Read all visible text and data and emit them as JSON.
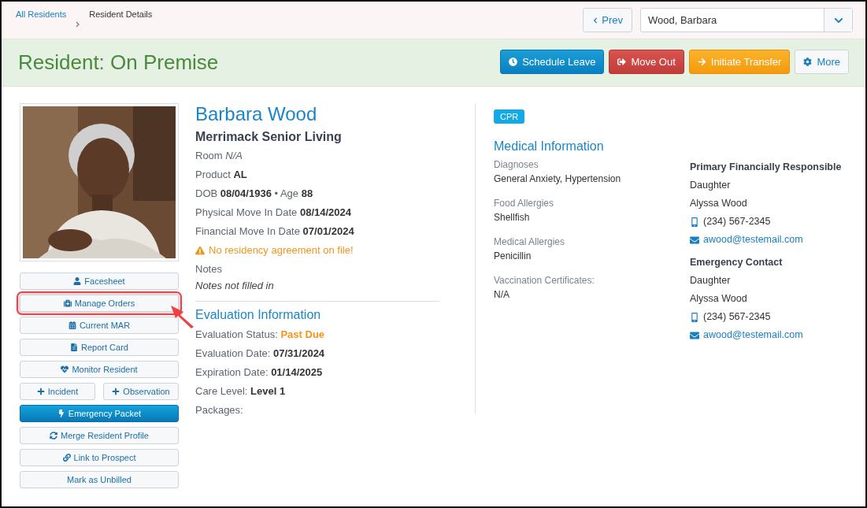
{
  "breadcrumbs": [
    {
      "label": "All Residents",
      "kind": "link"
    },
    {
      "label": "Resident Details",
      "kind": "current"
    }
  ],
  "nav": {
    "prev": "Prev",
    "resident_select": "Wood, Barbara"
  },
  "header": {
    "title": "Resident: On Premise",
    "actions": [
      {
        "label": "Schedule Leave",
        "kind": "info"
      },
      {
        "label": "Move Out",
        "kind": "danger"
      },
      {
        "label": "Initiate Transfer",
        "kind": "warning"
      },
      {
        "label": "More",
        "kind": "default"
      }
    ]
  },
  "photo": {
    "kind": "picture"
  },
  "side_buttons": [
    [
      {
        "label": "Facesheet",
        "kind": "profile",
        "highlighted": false
      }
    ],
    [
      {
        "label": "Manage Orders",
        "kind": "orders",
        "highlighted": true
      }
    ],
    [
      {
        "label": "Current MAR",
        "kind": "schedule",
        "highlighted": false
      }
    ],
    [
      {
        "label": "Report Card",
        "kind": "report",
        "highlighted": false
      }
    ],
    [
      {
        "label": "Monitor Resident",
        "kind": "monitor",
        "highlighted": false
      }
    ],
    [
      {
        "label": "Incident",
        "kind": "add",
        "highlighted": false
      },
      {
        "label": "Observation",
        "kind": "add",
        "highlighted": false
      }
    ],
    [
      {
        "label": "Emergency Packet",
        "kind": "emergency",
        "highlighted": false
      }
    ],
    [
      {
        "label": "Merge Resident Profile",
        "kind": "merge",
        "highlighted": false
      }
    ],
    [
      {
        "label": "Link to Prospect",
        "kind": "link",
        "highlighted": false
      }
    ],
    [
      {
        "label": "Mark as Unbilled",
        "kind": "plain",
        "highlighted": false
      }
    ]
  ],
  "resident": {
    "name": "Barbara Wood",
    "community": "Merrimack Senior Living",
    "details": [
      "Room *N/A*",
      "Product **AL**",
      "DOB **08/04/1936** • Age **88**",
      "Physical Move In Date **08/14/2024**",
      "Financial Move In Date **07/01/2024**"
    ],
    "warning": "No residency agreement on file!",
    "notes_label": "Notes",
    "notes_value": "Notes not filled in"
  },
  "evaluation": {
    "title": "Evaluation Information",
    "fields": [
      {
        "label": "Evaluation Status:",
        "value": "Past Due",
        "kind": "alert"
      },
      {
        "label": "Evaluation Date:",
        "value": "07/31/2024",
        "kind": "bold"
      },
      {
        "label": "Expiration Date:",
        "value": "01/14/2025",
        "kind": "bold"
      },
      {
        "label": "Care Level:",
        "value": "Level 1",
        "kind": "bold"
      },
      {
        "label": "Packages:"
      }
    ]
  },
  "badge": "CPR",
  "medical": {
    "title": "Medical Information",
    "items": [
      {
        "label": "Diagnoses",
        "value": "General Anxiety, Hypertension"
      },
      {
        "label": "Food Allergies",
        "value": "Shellfish"
      },
      {
        "label": "Medical Allergies",
        "value": "Penicillin"
      },
      {
        "label": "Vaccination Certificates:",
        "value": "N/A"
      }
    ]
  },
  "contacts": [
    {
      "title": "Primary Financially Responsible",
      "relation": "Daughter",
      "name": "Alyssa Wood",
      "phone": "(234) 567-2345",
      "email": "awood@testemail.com"
    },
    {
      "title": "Emergency Contact",
      "relation": "Daughter",
      "name": "Alyssa Wood",
      "phone": "(234) 567-2345",
      "email": "awood@testemail.com"
    }
  ]
}
